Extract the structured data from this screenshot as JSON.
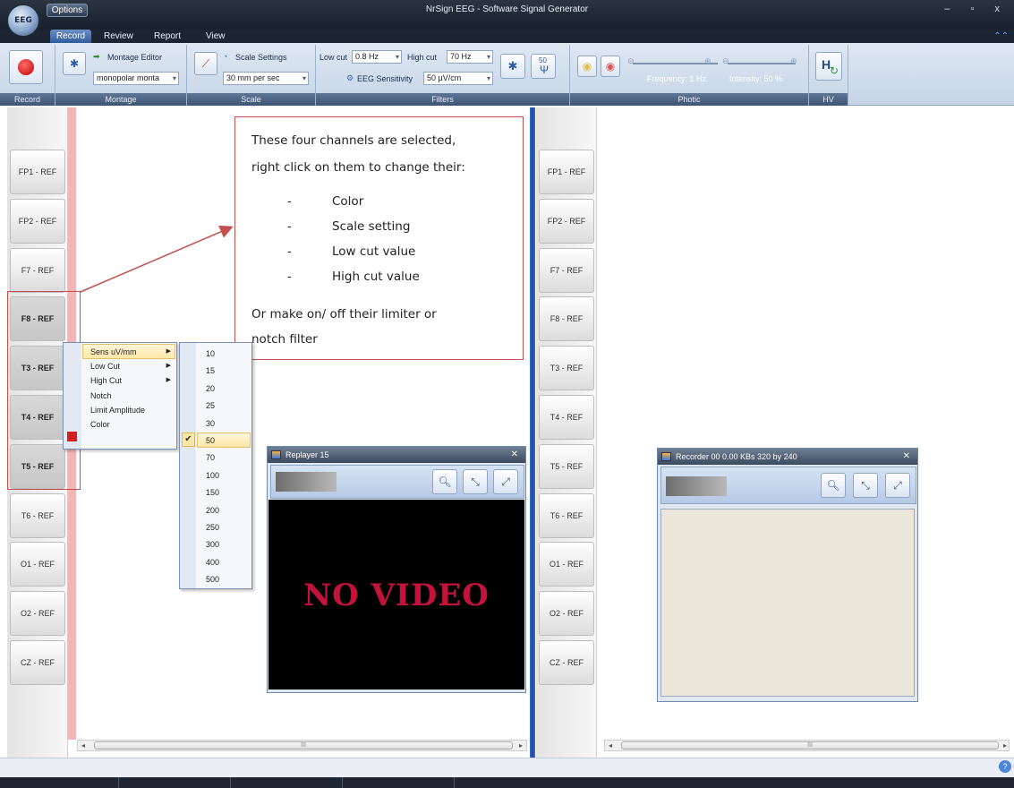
{
  "app": {
    "orb_label": "EEG",
    "options_label": "Options",
    "title": "NrSign EEG  -  Software Signal Generator",
    "window_controls": "– ▫ x"
  },
  "tabs": [
    "Record",
    "Review",
    "Report",
    "View"
  ],
  "ribbon": {
    "record_group": "Record",
    "montage": {
      "editor_label": "Montage Editor",
      "combo_value": "monopolar monta",
      "group": "Montage"
    },
    "scale": {
      "settings_label": "Scale Settings",
      "combo_value": "30 mm per sec",
      "group": "Scale"
    },
    "filters": {
      "low_cut_label": "Low cut",
      "low_cut_value": "0.8 Hz",
      "high_cut_label": "High cut",
      "high_cut_value": "70 Hz",
      "sensitivity_label": "EEG Sensitivity",
      "sensitivity_value": "50 µV/cm",
      "notch_value": "50",
      "group": "Filters"
    },
    "photic": {
      "frequency_label": "Frequency: 1 Hz",
      "intensity_label": "Intensity: 50 %",
      "group": "Photic"
    },
    "hv": {
      "button_label": "H",
      "group": "HV"
    }
  },
  "channels_left": [
    {
      "label": "FP1 - REF",
      "selected": false
    },
    {
      "label": "FP2 - REF",
      "selected": false
    },
    {
      "label": "F7 - REF",
      "selected": false
    },
    {
      "label": "F8 - REF",
      "selected": true
    },
    {
      "label": "T3 - REF",
      "selected": true
    },
    {
      "label": "T4 - REF",
      "selected": true
    },
    {
      "label": "T5 - REF",
      "selected": true
    },
    {
      "label": "T6 - REF",
      "selected": false
    },
    {
      "label": "O1 - REF",
      "selected": false
    },
    {
      "label": "O2 - REF",
      "selected": false
    },
    {
      "label": "CZ - REF",
      "selected": false
    }
  ],
  "channels_right": [
    "FP1 - REF",
    "FP2 - REF",
    "F7 - REF",
    "F8 - REF",
    "T3 - REF",
    "T4 - REF",
    "T5 - REF",
    "T6 - REF",
    "O1 - REF",
    "O2 - REF",
    "CZ - REF"
  ],
  "context_menu": {
    "items": [
      "Sens uV/mm",
      "Low Cut",
      "High Cut",
      "Notch",
      "Limit Amplitude",
      "Color"
    ],
    "highlighted": "Sens uV/mm",
    "color_swatch": "#d51f1f"
  },
  "sens_submenu": {
    "items": [
      "10",
      "15",
      "20",
      "25",
      "30",
      "50",
      "70",
      "100",
      "150",
      "200",
      "250",
      "300",
      "400",
      "500"
    ],
    "checked": "50"
  },
  "annotation": {
    "line1": "These four channels are selected,",
    "line2": "right click on them to change their:",
    "bullets": [
      "Color",
      "Scale setting",
      "Low cut value",
      "High cut value"
    ],
    "line3": "Or make on/ off their limiter or",
    "line4": "notch filter",
    "border_color": "#c0504d"
  },
  "replayer": {
    "title": "Replayer  15",
    "message": "NO VIDEO"
  },
  "recorder": {
    "title": "Recorder  00   0.00 KBs   320 by 240"
  },
  "scrollbar": {
    "thumb_grip": "III"
  },
  "help": "?"
}
